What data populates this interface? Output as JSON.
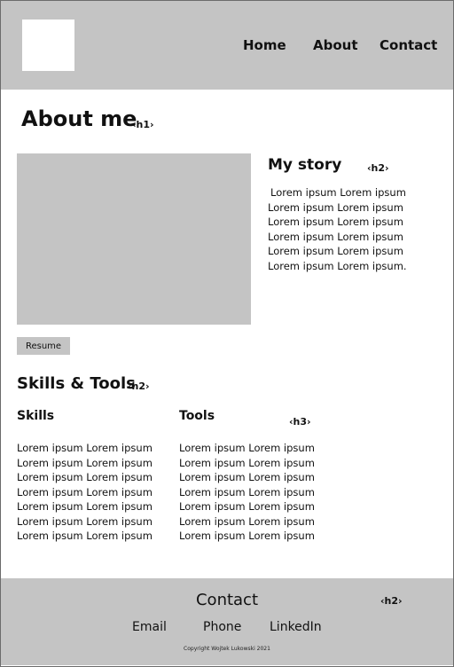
{
  "header": {
    "nav": [
      "Home",
      "About",
      "Contact"
    ]
  },
  "about": {
    "title": "About me",
    "title_tag": "‹h1›"
  },
  "story": {
    "title": "My story",
    "tag": "‹h2›",
    "lines": [
      "Lorem ipsum Lorem ipsum",
      "Lorem ipsum Lorem ipsum",
      "Lorem ipsum Lorem ipsum",
      "Lorem ipsum Lorem ipsum",
      "Lorem ipsum Lorem ipsum",
      "Lorem ipsum Lorem ipsum."
    ]
  },
  "resume_label": "Resume",
  "skills_tools": {
    "title": "Skills & Tools",
    "tag": "‹h2›",
    "skills_title": "Skills",
    "tools_title": "Tools",
    "h3_tag": "‹h3›",
    "skills": [
      "Lorem ipsum Lorem ipsum",
      "Lorem ipsum Lorem ipsum",
      "Lorem ipsum Lorem ipsum",
      "Lorem ipsum Lorem ipsum",
      "Lorem ipsum Lorem ipsum",
      "Lorem ipsum Lorem ipsum",
      "Lorem ipsum Lorem ipsum"
    ],
    "tools": [
      "Lorem ipsum Lorem ipsum",
      "Lorem ipsum Lorem ipsum",
      "Lorem ipsum Lorem ipsum",
      "Lorem ipsum Lorem ipsum",
      "Lorem ipsum Lorem ipsum",
      "Lorem ipsum Lorem ipsum",
      "Lorem ipsum Lorem ipsum"
    ]
  },
  "footer": {
    "title": "Contact",
    "tag": "‹h2›",
    "links": [
      "Email",
      "Phone",
      "LinkedIn"
    ],
    "copyright": "Copyright Wojtek Lukowski 2021"
  }
}
